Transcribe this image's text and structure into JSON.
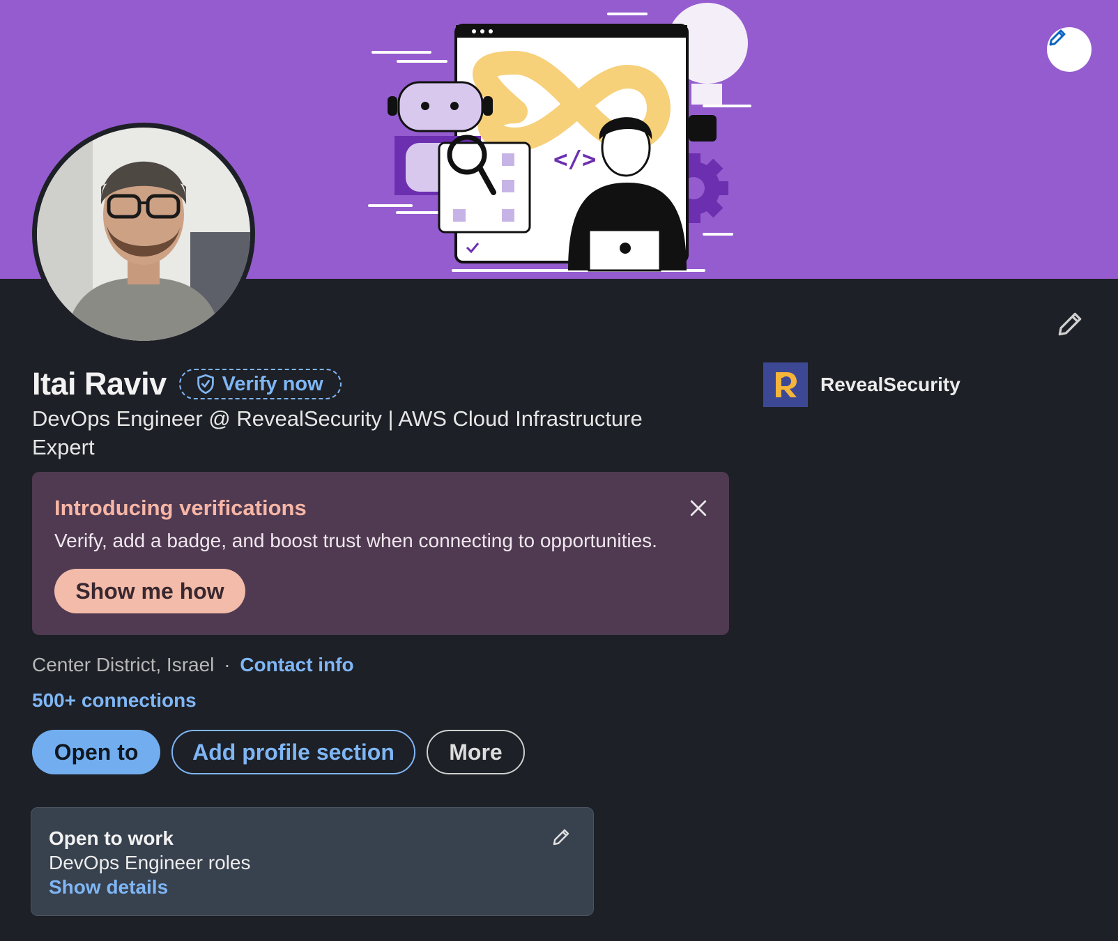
{
  "profile": {
    "name": "Itai Raviv",
    "verify_label": "Verify now",
    "headline": "DevOps Engineer @ RevealSecurity | AWS Cloud Infrastructure Expert",
    "location": "Center District, Israel",
    "separator": "·",
    "contact_label": "Contact info",
    "connections": "500+ connections"
  },
  "company": {
    "name": "RevealSecurity",
    "logo_colors": {
      "background": "#3d4895",
      "mark": "#f5b43a"
    }
  },
  "promo": {
    "title": "Introducing verifications",
    "text": "Verify, add a badge, and boost trust when connecting to opportunities.",
    "button": "Show me how"
  },
  "actions": {
    "open_to": "Open to",
    "add_section": "Add profile section",
    "more": "More"
  },
  "open_to_work": {
    "title": "Open to work",
    "subtitle": "DevOps Engineer roles",
    "link": "Show details"
  },
  "banner": {
    "code_glyph": "</>"
  },
  "colors": {
    "banner": "#955ccf",
    "background": "#1d2026",
    "accent": "#7fb6f5",
    "promo_bg": "#4f3a51",
    "promo_title": "#f7b6a6",
    "promo_button": "#f3bba9"
  },
  "icons": [
    "pencil-icon",
    "shield-check-icon",
    "close-icon"
  ]
}
